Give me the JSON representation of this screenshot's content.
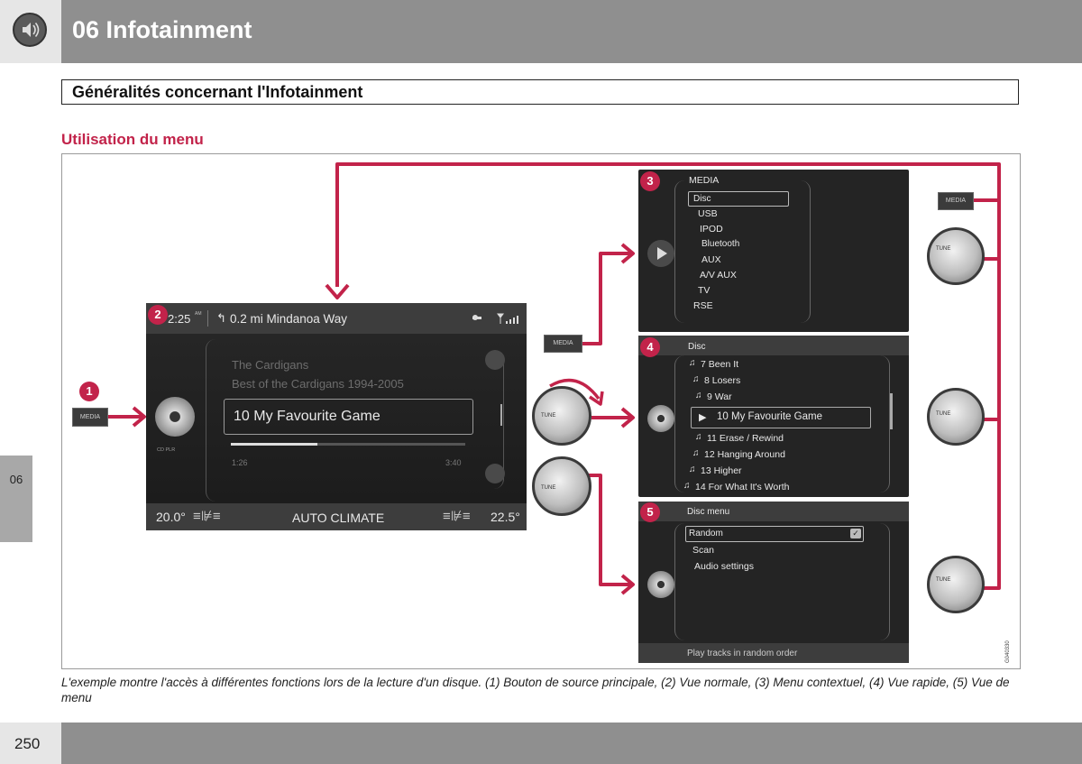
{
  "header": {
    "chapter_title": "06  Infotainment",
    "icon": "speaker-icon"
  },
  "section_title": "Généralités concernant l'Infotainment",
  "subheading": "Utilisation du menu",
  "side_tab": "06",
  "figure": {
    "badges": [
      "1",
      "2",
      "3",
      "4",
      "5"
    ],
    "media_button_label": "MEDIA",
    "tune_label": "TUNE",
    "figure_code": "G040330",
    "normal_view": {
      "time": "2:25",
      "time_suffix": "AM",
      "nav_text": "0.2 mi Mindanoa Way",
      "artist": "The Cardigans",
      "album": "Best of the Cardigans 1994-2005",
      "track": "10 My Favourite Game",
      "progress_fraction": 0.37,
      "elapsed": "1:26",
      "duration": "3:40",
      "disc_label": "CD PLR",
      "temp_left": "20.0°",
      "climate": "AUTO CLIMATE",
      "temp_right": "22.5°"
    },
    "context_menu": {
      "title": "MEDIA",
      "items": [
        "Disc",
        "USB",
        "IPOD",
        "Bluetooth",
        "AUX",
        "A/V AUX",
        "TV",
        "RSE"
      ]
    },
    "quick_view": {
      "title": "Disc",
      "tracks": [
        "7 Been It",
        "8 Losers",
        "9 War",
        "10 My Favourite Game",
        "11 Erase / Rewind",
        "12 Hanging Around",
        "13 Higher",
        "14 For What It's Worth"
      ]
    },
    "menu_view": {
      "title": "Disc menu",
      "items": [
        "Random",
        "Scan",
        "Audio settings"
      ],
      "footer": "Play tracks in random order"
    }
  },
  "caption": "L'exemple montre l'accès à différentes fonctions lors de la lecture d'un disque. (1) Bouton de source principale, (2) Vue normale, (3) Menu contextuel, (4) Vue rapide, (5) Vue de menu",
  "page_number": "250",
  "colors": {
    "accent": "#c2234a",
    "header_gray": "#8f8f8f",
    "screen_bg": "#242424"
  }
}
